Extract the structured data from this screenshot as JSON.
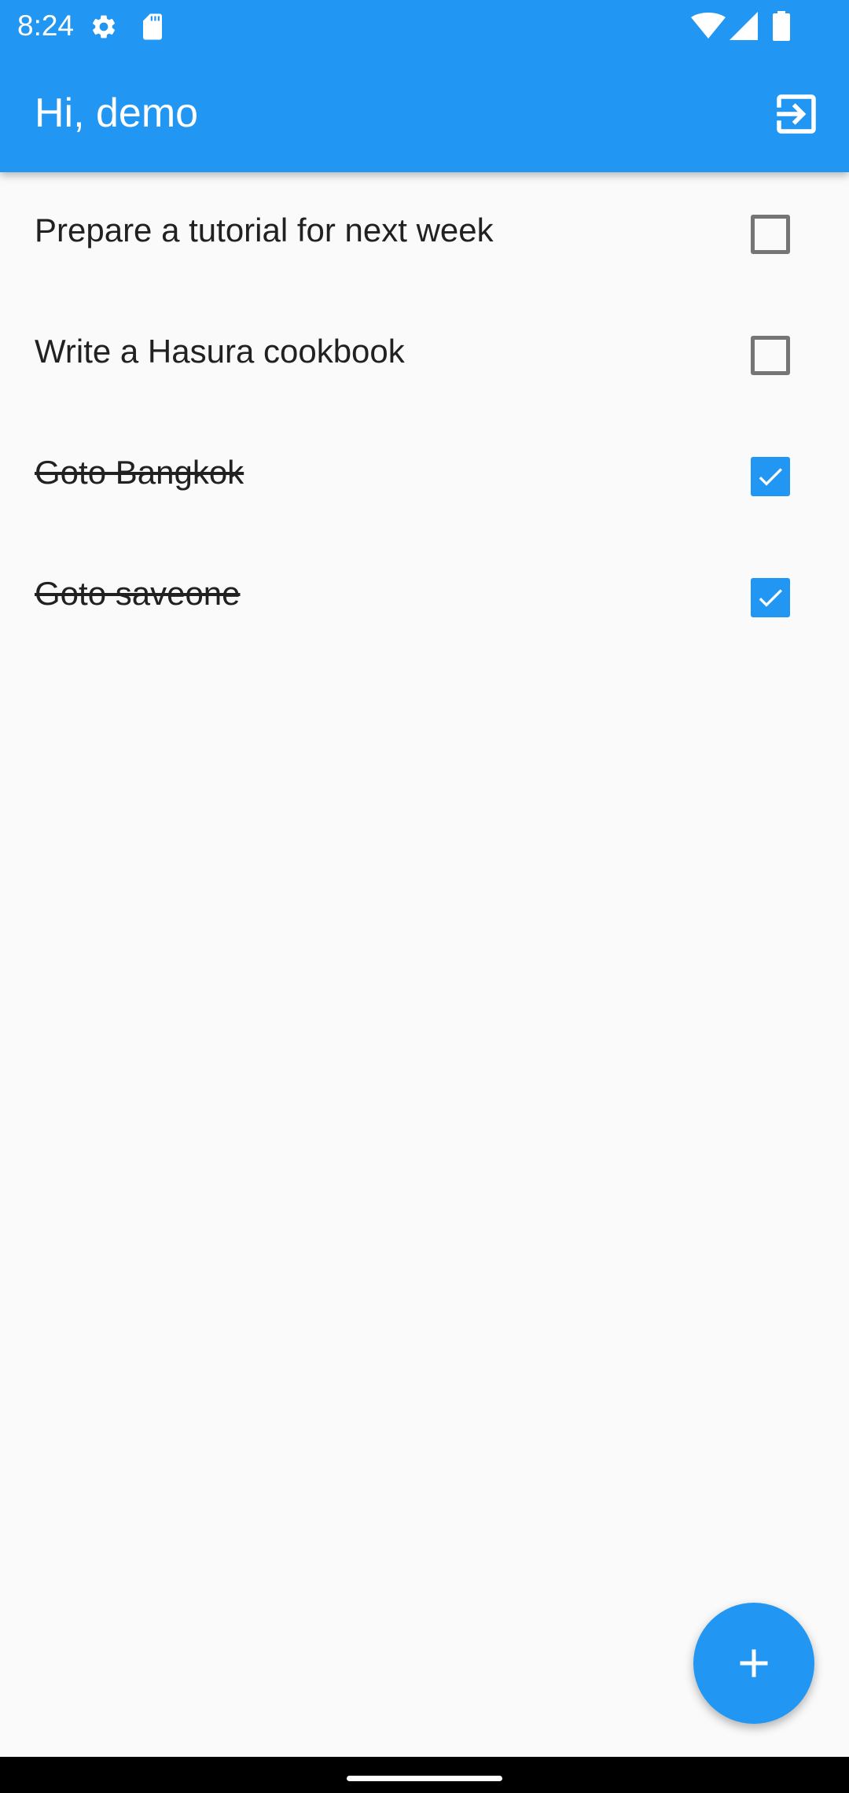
{
  "status_bar": {
    "time": "8:24",
    "icons": [
      "gear-icon",
      "sd-card-icon",
      "wifi-icon",
      "signal-icon",
      "battery-icon"
    ]
  },
  "app_bar": {
    "title": "Hi, demo",
    "action_icon": "logout-icon"
  },
  "todos": [
    {
      "text": "Prepare a tutorial for next week",
      "completed": false
    },
    {
      "text": "Write a Hasura cookbook",
      "completed": false
    },
    {
      "text": "Goto Bangkok",
      "completed": true
    },
    {
      "text": "Goto saveone",
      "completed": true
    }
  ],
  "fab": {
    "icon": "plus-icon"
  },
  "colors": {
    "primary": "#2196f3",
    "background": "#fafafa",
    "text": "#212121",
    "checkbox_border": "#757575"
  }
}
